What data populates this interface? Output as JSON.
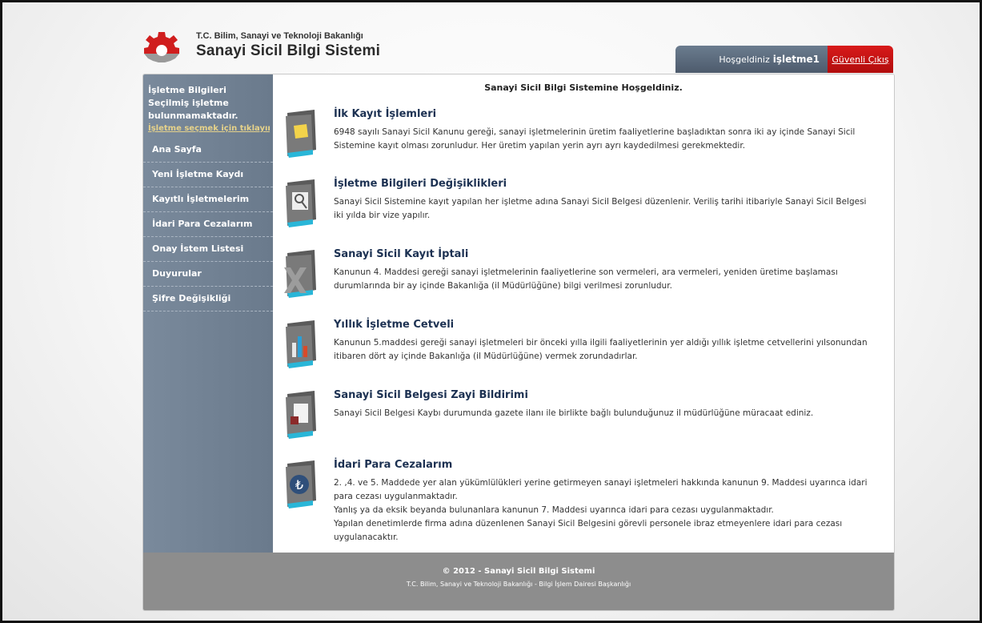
{
  "header": {
    "ministry": "T.C. Bilim, Sanayi ve Teknoloji Bakanlığı",
    "system_name": "Sanayi Sicil Bilgi Sistemi",
    "welcome_prefix": "Hoşgeldiniz",
    "username": "işletme1",
    "logout_label": "Güvenli Çıkış"
  },
  "sidebar": {
    "info_title": "İşletme Bilgileri",
    "info_text": "Seçilmiş işletme bulunmamaktadır.",
    "select_link": "İşletme seçmek için tıklayınız.",
    "items": [
      {
        "label": "Ana Sayfa"
      },
      {
        "label": "Yeni İşletme Kaydı"
      },
      {
        "label": "Kayıtlı İşletmelerim"
      },
      {
        "label": "İdari Para Cezalarım"
      },
      {
        "label": "Onay İstem Listesi"
      },
      {
        "label": "Duyurular"
      },
      {
        "label": "Şifre Değişikliği"
      }
    ]
  },
  "main": {
    "welcome": "Sanayi Sicil Bilgi Sistemine Hoşgeldiniz.",
    "sections": [
      {
        "title": "İlk Kayıt İşlemleri",
        "text": "6948 sayılı Sanayi Sicil Kanunu gereği, sanayi işletmelerinin üretim faaliyetlerine başladıktan sonra iki ay içinde Sanayi Sicil Sistemine kayıt olması zorunludur. Her üretim yapılan yerin ayrı ayrı kaydedilmesi gerekmektedir."
      },
      {
        "title": "İşletme Bilgileri Değişiklikleri",
        "text": "Sanayi Sicil Sistemine kayıt yapılan her işletme adına Sanayi Sicil Belgesi düzenlenir. Veriliş tarihi itibariyle Sanayi Sicil Belgesi iki yılda bir vize yapılır."
      },
      {
        "title": "Sanayi Sicil Kayıt İptali",
        "text": "Kanunun 4. Maddesi gereği sanayi işletmelerinin faaliyetlerine son vermeleri, ara vermeleri, yeniden üretime başlaması durumlarında bir ay içinde Bakanlığa (il Müdürlüğüne) bilgi verilmesi zorunludur."
      },
      {
        "title": "Yıllık İşletme Cetveli",
        "text": "Kanunun 5.maddesi gereği sanayi işletmeleri bir önceki yılla ilgili faaliyetlerinin yer aldığı yıllık işletme cetvellerini yılsonundan itibaren dört ay içinde Bakanlığa (il Müdürlüğüne) vermek zorundadırlar."
      },
      {
        "title": "Sanayi Sicil Belgesi Zayi Bildirimi",
        "text": "Sanayi Sicil Belgesi Kaybı durumunda gazete ilanı ile birlikte bağlı bulunduğunuz il müdürlüğüne müracaat ediniz."
      },
      {
        "title": "İdari Para Cezalarım",
        "text": "2. ,4. ve 5. Maddede yer alan yükümlülükleri yerine getirmeyen sanayi işletmeleri hakkında kanunun 9. Maddesi uyarınca idari para cezası uygulanmaktadır.",
        "text2": "Yanlış ya da eksik beyanda bulunanlara kanunun 7. Maddesi uyarınca idari para cezası uygulanmaktadır.",
        "text3": "Yapılan denetimlerde firma adına düzenlenen Sanayi Sicil Belgesini görevli personele ibraz etmeyenlere idari para cezası uygulanacaktır."
      }
    ],
    "lira_symbol": "₺"
  },
  "footer": {
    "copyright": "© 2012 - Sanayi Sicil Bilgi Sistemi",
    "org": "T.C. Bilim, Sanayi ve Teknoloji Bakanlığı - Bilgi İşlem Dairesi Başkanlığı"
  },
  "colors": {
    "accent_red": "#c40f0f",
    "sidebar": "#73859a",
    "title_blue": "#1c3152"
  }
}
